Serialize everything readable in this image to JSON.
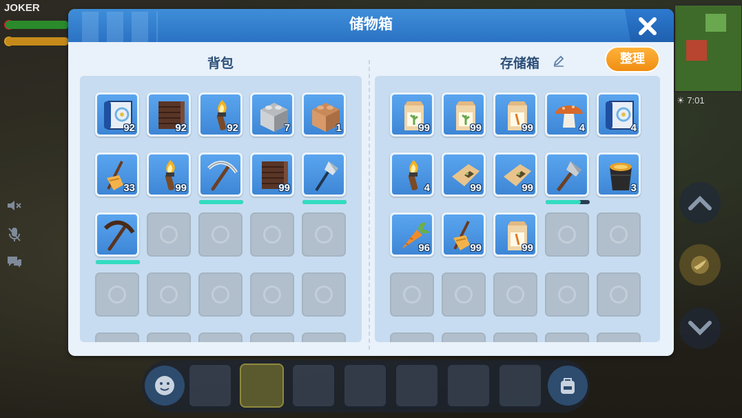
{
  "hud": {
    "player_name": "JOKER",
    "clock": "7:01"
  },
  "dialog": {
    "title": "储物箱",
    "backpack_title": "背包",
    "storage_title": "存储箱",
    "sort_label": "整理"
  },
  "backpack": {
    "rows": [
      [
        {
          "icon": "blueprint-icon",
          "count": "92"
        },
        {
          "icon": "wood-fence-icon",
          "count": "92"
        },
        {
          "icon": "torch-icon",
          "count": "92"
        },
        {
          "icon": "stone-block-icon",
          "count": "7"
        },
        {
          "icon": "dirt-block-icon",
          "count": "1"
        }
      ],
      [
        {
          "icon": "bundle-icon",
          "count": "33"
        },
        {
          "icon": "torch-icon",
          "count": "99"
        },
        {
          "icon": "iron-pickaxe-icon",
          "count": "",
          "durability": 1.0
        },
        {
          "icon": "wood-fence-icon",
          "count": "99"
        },
        {
          "icon": "iron-axe-icon",
          "count": "",
          "durability": 1.0
        }
      ],
      [
        {
          "icon": "wood-pickaxe-icon",
          "count": "",
          "durability": 1.0
        },
        {
          "icon": "empty"
        },
        {
          "icon": "empty"
        },
        {
          "icon": "empty"
        },
        {
          "icon": "empty"
        }
      ],
      [
        {
          "icon": "empty"
        },
        {
          "icon": "empty"
        },
        {
          "icon": "empty"
        },
        {
          "icon": "empty"
        },
        {
          "icon": "empty"
        }
      ]
    ]
  },
  "storage": {
    "rows": [
      [
        {
          "icon": "seed-bag-green-icon",
          "count": "99"
        },
        {
          "icon": "seed-bag-green-icon",
          "count": "99"
        },
        {
          "icon": "seed-bag-orange-icon",
          "count": "99"
        },
        {
          "icon": "mushroom-icon",
          "count": "4"
        },
        {
          "icon": "blueprint-icon",
          "count": "4"
        }
      ],
      [
        {
          "icon": "torch-icon",
          "count": "4"
        },
        {
          "icon": "seed-pack-icon",
          "count": "99"
        },
        {
          "icon": "seed-pack-icon",
          "count": "99"
        },
        {
          "icon": "stone-axe-icon",
          "count": "",
          "durability": 0.8
        },
        {
          "icon": "bucket-icon",
          "count": "3"
        }
      ],
      [
        {
          "icon": "carrot-icon",
          "count": "96"
        },
        {
          "icon": "bundle-icon",
          "count": "99"
        },
        {
          "icon": "seed-bag-orange-icon",
          "count": "99"
        },
        {
          "icon": "empty"
        },
        {
          "icon": "empty"
        }
      ],
      [
        {
          "icon": "empty"
        },
        {
          "icon": "empty"
        },
        {
          "icon": "empty"
        },
        {
          "icon": "empty"
        },
        {
          "icon": "empty"
        }
      ]
    ]
  }
}
